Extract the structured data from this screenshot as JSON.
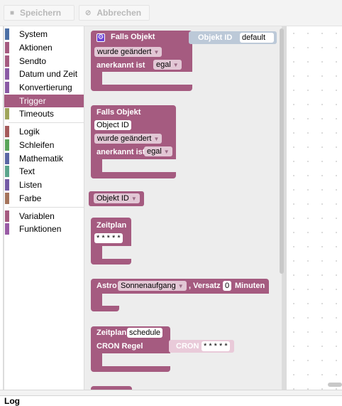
{
  "toolbar": {
    "save_label": "Speichern",
    "cancel_label": "Abbrechen",
    "save_icon": "save-icon",
    "cancel_icon": "cancel-icon"
  },
  "categories": [
    {
      "label": "System",
      "color": "#4c6fa5"
    },
    {
      "label": "Aktionen",
      "color": "#a55b80"
    },
    {
      "label": "Sendto",
      "color": "#a55b80"
    },
    {
      "label": "Datum und Zeit",
      "color": "#8a5ba5"
    },
    {
      "label": "Konvertierung",
      "color": "#8a5ba5"
    },
    {
      "label": "Trigger",
      "color": "#a55b80",
      "selected": true
    },
    {
      "label": "Timeouts",
      "color": "#9fa55b"
    },
    {
      "label": "Logik",
      "color": "#a55b5b"
    },
    {
      "label": "Schleifen",
      "color": "#5ba55b"
    },
    {
      "label": "Mathematik",
      "color": "#5b67a5"
    },
    {
      "label": "Text",
      "color": "#5ba58c"
    },
    {
      "label": "Listen",
      "color": "#745ba5"
    },
    {
      "label": "Farbe",
      "color": "#a5745b"
    },
    {
      "label": "Variablen",
      "color": "#a55b80"
    },
    {
      "label": "Funktionen",
      "color": "#995ba5"
    }
  ],
  "blocks": {
    "b1": {
      "title": "Falls Objekt",
      "objid_label": "Objekt ID",
      "objid_value": "default",
      "changed": "wurde geändert",
      "ack_label": "anerkannt ist",
      "ack_value": "egal"
    },
    "b2": {
      "title": "Falls Objekt",
      "objid_value": "Object ID",
      "changed": "wurde geändert",
      "ack_label": "anerkannt ist",
      "ack_value": "egal"
    },
    "b3": {
      "value": "Objekt ID"
    },
    "b4": {
      "title": "Zeitplan",
      "value": "* * * * *"
    },
    "b5": {
      "label": "Astro",
      "event": "Sonnenaufgang",
      "offset_label": ", Versatz",
      "offset": "0",
      "unit": "Minuten"
    },
    "b6": {
      "title": "Zeitplan",
      "name": "schedule",
      "cron_label": "CRON Regel",
      "cron_inner": "CRON",
      "cron_value": "* * * * *"
    }
  },
  "log": {
    "label": "Log"
  },
  "colors": {
    "trigger": "#a55b80",
    "selected_bg": "#a55b80"
  }
}
